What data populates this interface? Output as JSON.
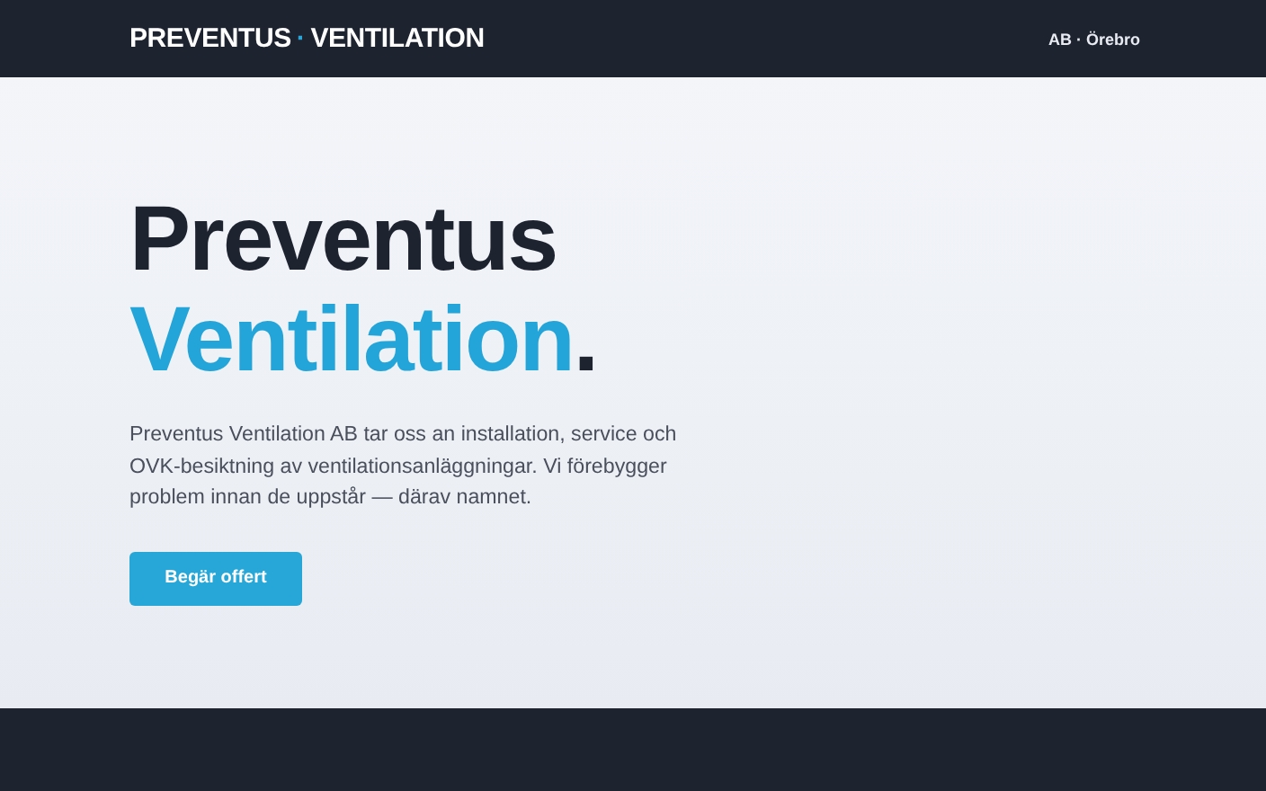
{
  "header": {
    "logo": {
      "first": "PREVENTUS",
      "separator": "·",
      "second": "VENTILATION"
    },
    "tagline": "AB · Örebro"
  },
  "hero": {
    "title_line_1": "Preventus",
    "title_line_2": "Ventilation",
    "title_end": ".",
    "description": "Preventus Ventilation AB tar oss an installation, service och OVK-besiktning av ventilationsanläggningar. Vi förebygger problem innan de uppstår — därav namnet.",
    "button": "Begär offert"
  }
}
